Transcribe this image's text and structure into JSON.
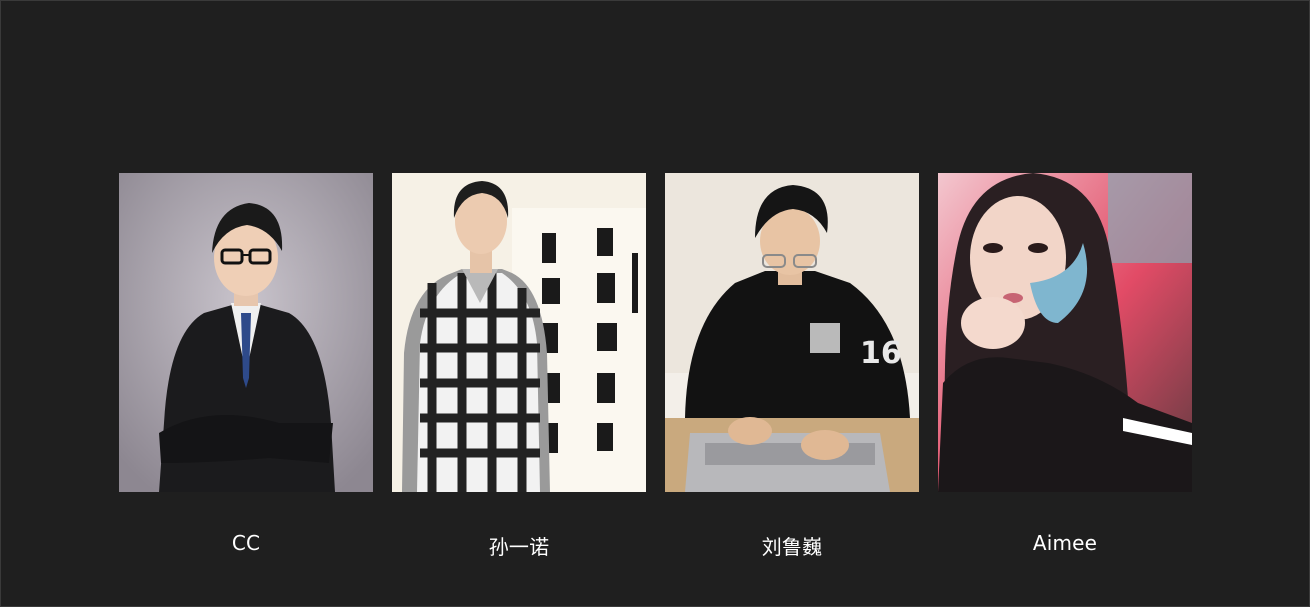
{
  "team": {
    "members": [
      {
        "name": "CC",
        "photo_icon": "portrait-suit-icon"
      },
      {
        "name": "孙一诺",
        "photo_icon": "portrait-calligraphy-icon"
      },
      {
        "name": "刘鲁巍",
        "photo_icon": "portrait-laptop-icon"
      },
      {
        "name": "Aimee",
        "photo_icon": "portrait-selfie-icon"
      }
    ]
  },
  "colors": {
    "background": "#1f1f1f",
    "caption": "#ffffff"
  }
}
